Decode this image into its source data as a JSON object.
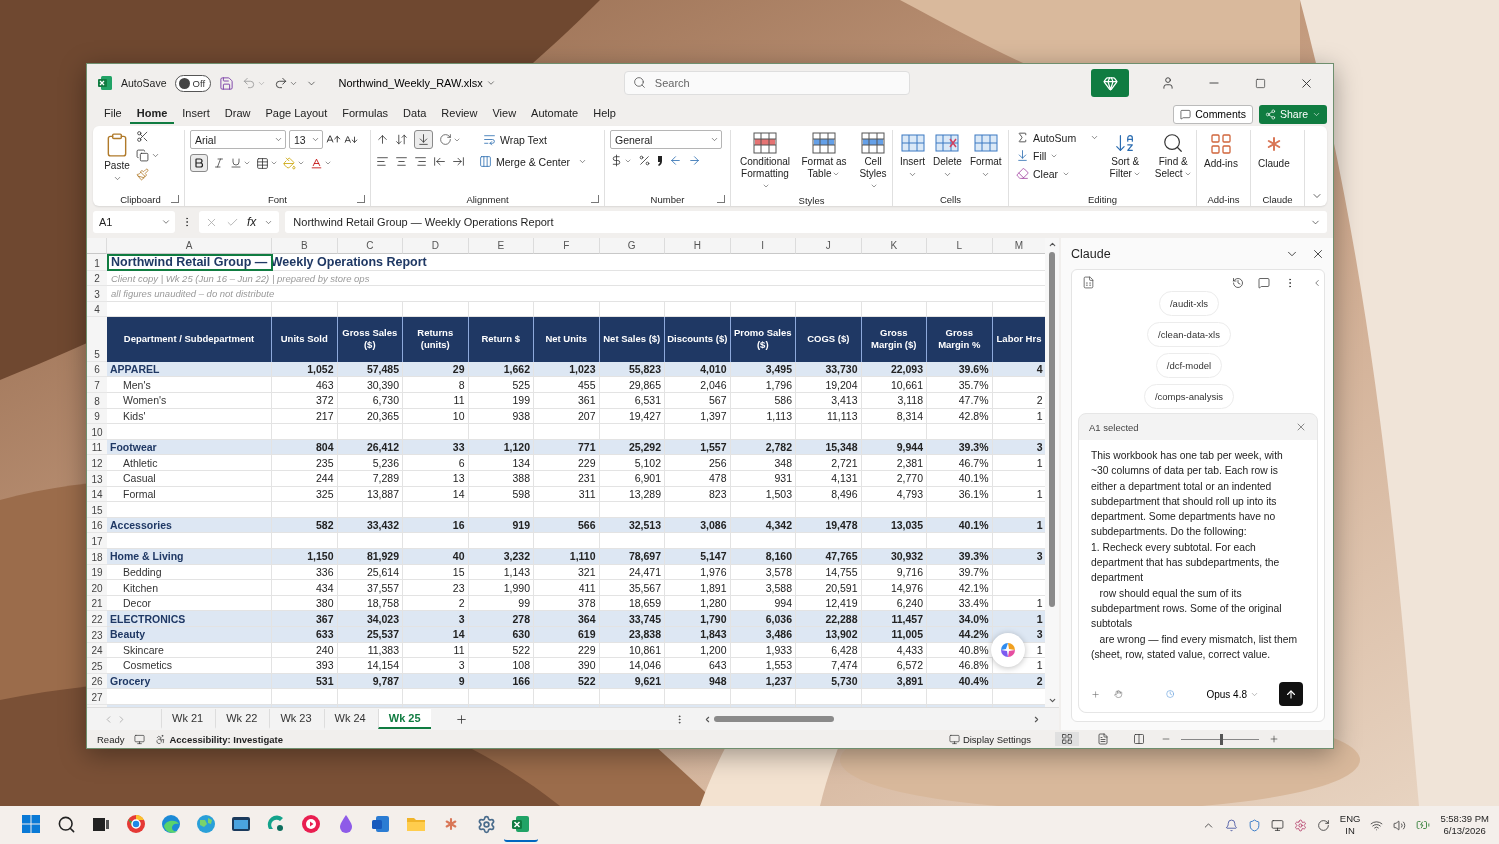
{
  "title_bar": {
    "autosave_label": "AutoSave",
    "autosave": {
      "on": false,
      "label": "Off"
    },
    "filename": "Northwind_Weekly_RAW.xlsx",
    "search": {
      "placeholder": "Search"
    }
  },
  "menu_tabs": [
    {
      "label": "File",
      "selected": false
    },
    {
      "label": "Home",
      "selected": true
    },
    {
      "label": "Insert",
      "selected": false
    },
    {
      "label": "Draw",
      "selected": false
    },
    {
      "label": "Page Layout",
      "selected": false
    },
    {
      "label": "Formulas",
      "selected": false
    },
    {
      "label": "Data",
      "selected": false
    },
    {
      "label": "Review",
      "selected": false
    },
    {
      "label": "View",
      "selected": false
    },
    {
      "label": "Automate",
      "selected": false
    },
    {
      "label": "Help",
      "selected": false
    }
  ],
  "comments_button": "Comments",
  "share_button": "Share",
  "ribbon": {
    "clipboard": {
      "label": "Clipboard",
      "paste": "Paste"
    },
    "font": {
      "label": "Font",
      "font_name": "Arial",
      "font_size": "13",
      "bold": true
    },
    "alignment": {
      "label": "Alignment",
      "align_bottom": true,
      "wrap_text": "Wrap Text",
      "merge_center": "Merge & Center"
    },
    "number": {
      "label": "Number",
      "format": "General"
    },
    "styles": {
      "label": "Styles",
      "buttons": [
        "Conditional Formatting",
        "Format as Table",
        "Cell Styles"
      ]
    },
    "cells": {
      "label": "Cells",
      "buttons": [
        "Insert",
        "Delete",
        "Format"
      ]
    },
    "editing": {
      "label": "Editing",
      "autosum": "AutoSum",
      "fill": "Fill",
      "clear": "Clear",
      "buttons": [
        "Sort & Filter",
        "Find & Select"
      ]
    },
    "addins": {
      "label": "Add-ins",
      "button": "Add-ins"
    },
    "claude": {
      "label": "Claude",
      "button": "Claude"
    }
  },
  "formula_bar": {
    "cell_ref": "A1",
    "function_label": "fx",
    "value": "Northwind Retail Group — Weekly Operations Report"
  },
  "sheet": {
    "columns": [
      "A",
      "B",
      "C",
      "D",
      "E",
      "F",
      "G",
      "H",
      "I",
      "J",
      "K",
      "L",
      "M"
    ],
    "top_rows": [
      {
        "num": "1",
        "kind": "title",
        "text": "Northwind Retail Group — Weekly Operations Report"
      },
      {
        "num": "2",
        "kind": "note",
        "text": "Client copy  |  Wk 25  (Jun 16 – Jun 22)  |  prepared by store ops"
      },
      {
        "num": "3",
        "kind": "note",
        "text": "all figures unaudited – do not distribute"
      },
      {
        "num": "4",
        "kind": "blank"
      }
    ],
    "header_row": {
      "num": "5",
      "labels": [
        "Department / Subdepartment",
        "Units Sold",
        "Gross Sales ($)",
        "Returns (units)",
        "Return $",
        "Net Units",
        "Net Sales ($)",
        "Discounts ($)",
        "Promo Sales ($)",
        "COGS ($)",
        "Gross Margin ($)",
        "Gross Margin %",
        "Labor Hrs"
      ]
    },
    "rows": [
      {
        "num": "6",
        "kind": "department",
        "name": "APPAREL",
        "values": [
          "1,052",
          "57,485",
          "29",
          "1,662",
          "1,023",
          "55,823",
          "4,010",
          "3,495",
          "33,730",
          "22,093",
          "39.6%"
        ],
        "labor_hrs": "4"
      },
      {
        "num": "7",
        "kind": "sub",
        "name": "Men's",
        "values": [
          "463",
          "30,390",
          "8",
          "525",
          "455",
          "29,865",
          "2,046",
          "1,796",
          "19,204",
          "10,661",
          "35.7%"
        ]
      },
      {
        "num": "8",
        "kind": "sub",
        "name": "Women's",
        "values": [
          "372",
          "6,730",
          "11",
          "199",
          "361",
          "6,531",
          "567",
          "586",
          "3,413",
          "3,118",
          "47.7%"
        ],
        "labor_hrs": "2"
      },
      {
        "num": "9",
        "kind": "sub",
        "name": "Kids'",
        "values": [
          "217",
          "20,365",
          "10",
          "938",
          "207",
          "19,427",
          "1,397",
          "1,113",
          "11,113",
          "8,314",
          "42.8%"
        ],
        "labor_hrs": "1"
      },
      {
        "num": "10",
        "kind": "blank"
      },
      {
        "num": "11",
        "kind": "department",
        "name": "Footwear",
        "values": [
          "804",
          "26,412",
          "33",
          "1,120",
          "771",
          "25,292",
          "1,557",
          "2,782",
          "15,348",
          "9,944",
          "39.3%"
        ],
        "labor_hrs": "3"
      },
      {
        "num": "12",
        "kind": "sub",
        "name": "Athletic",
        "values": [
          "235",
          "5,236",
          "6",
          "134",
          "229",
          "5,102",
          "256",
          "348",
          "2,721",
          "2,381",
          "46.7%"
        ],
        "labor_hrs": "1"
      },
      {
        "num": "13",
        "kind": "sub",
        "name": "Casual",
        "values": [
          "244",
          "7,289",
          "13",
          "388",
          "231",
          "6,901",
          "478",
          "931",
          "4,131",
          "2,770",
          "40.1%"
        ]
      },
      {
        "num": "14",
        "kind": "sub",
        "name": "Formal",
        "values": [
          "325",
          "13,887",
          "14",
          "598",
          "311",
          "13,289",
          "823",
          "1,503",
          "8,496",
          "4,793",
          "36.1%"
        ],
        "labor_hrs": "1"
      },
      {
        "num": "15",
        "kind": "blank"
      },
      {
        "num": "16",
        "kind": "department",
        "name": "Accessories",
        "values": [
          "582",
          "33,432",
          "16",
          "919",
          "566",
          "32,513",
          "3,086",
          "4,342",
          "19,478",
          "13,035",
          "40.1%"
        ],
        "labor_hrs": "1"
      },
      {
        "num": "17",
        "kind": "blank"
      },
      {
        "num": "18",
        "kind": "department",
        "name": "Home & Living",
        "values": [
          "1,150",
          "81,929",
          "40",
          "3,232",
          "1,110",
          "78,697",
          "5,147",
          "8,160",
          "47,765",
          "30,932",
          "39.3%"
        ],
        "labor_hrs": "3"
      },
      {
        "num": "19",
        "kind": "sub",
        "name": "Bedding",
        "values": [
          "336",
          "25,614",
          "15",
          "1,143",
          "321",
          "24,471",
          "1,976",
          "3,578",
          "14,755",
          "9,716",
          "39.7%"
        ]
      },
      {
        "num": "20",
        "kind": "sub",
        "name": "Kitchen",
        "values": [
          "434",
          "37,557",
          "23",
          "1,990",
          "411",
          "35,567",
          "1,891",
          "3,588",
          "20,591",
          "14,976",
          "42.1%"
        ]
      },
      {
        "num": "21",
        "kind": "sub",
        "name": "Decor",
        "values": [
          "380",
          "18,758",
          "2",
          "99",
          "378",
          "18,659",
          "1,280",
          "994",
          "12,419",
          "6,240",
          "33.4%"
        ],
        "labor_hrs": "1"
      },
      {
        "num": "22",
        "kind": "department",
        "name": "ELECTRONICS",
        "values": [
          "367",
          "34,023",
          "3",
          "278",
          "364",
          "33,745",
          "1,790",
          "6,036",
          "22,288",
          "11,457",
          "34.0%"
        ],
        "labor_hrs": "1"
      },
      {
        "num": "23",
        "kind": "department",
        "name": "Beauty",
        "values": [
          "633",
          "25,537",
          "14",
          "630",
          "619",
          "23,838",
          "1,843",
          "3,486",
          "13,902",
          "11,005",
          "44.2%"
        ],
        "labor_hrs": "3"
      },
      {
        "num": "24",
        "kind": "sub",
        "name": "Skincare",
        "values": [
          "240",
          "11,383",
          "11",
          "522",
          "229",
          "10,861",
          "1,200",
          "1,933",
          "6,428",
          "4,433",
          "40.8%"
        ],
        "labor_hrs": "1"
      },
      {
        "num": "25",
        "kind": "sub",
        "name": "Cosmetics",
        "values": [
          "393",
          "14,154",
          "3",
          "108",
          "390",
          "14,046",
          "643",
          "1,553",
          "7,474",
          "6,572",
          "46.8%"
        ],
        "labor_hrs": "1"
      },
      {
        "num": "26",
        "kind": "department",
        "name": "Grocery",
        "values": [
          "531",
          "9,787",
          "9",
          "166",
          "522",
          "9,621",
          "948",
          "1,237",
          "5,730",
          "3,891",
          "40.4%"
        ],
        "labor_hrs": "2"
      },
      {
        "num": "27",
        "kind": "blank"
      }
    ]
  },
  "sheet_tabs": [
    {
      "label": "Wk 21",
      "selected": false
    },
    {
      "label": "Wk 22",
      "selected": false
    },
    {
      "label": "Wk 23",
      "selected": false
    },
    {
      "label": "Wk 24",
      "selected": false
    },
    {
      "label": "Wk 25",
      "selected": true
    }
  ],
  "status_bar": {
    "ready": "Ready",
    "accessibility": "Accessibility: Investigate",
    "display_settings": "Display Settings",
    "views": [
      {
        "kind": "normal",
        "selected": true
      },
      {
        "kind": "page_layout",
        "selected": false
      },
      {
        "kind": "page_break",
        "selected": false
      }
    ],
    "zoom": {
      "level": 0.5
    }
  },
  "claude_panel": {
    "title": "Claude",
    "skills": [
      "/audit-xls",
      "/clean-data-xls",
      "/dcf-model",
      "/comps-analysis"
    ],
    "context": "A1 selected",
    "prompt": {
      "value": "This workbook has one tab per week, with ~30 columns of data per tab. Each row is either a department total or an indented subdepartment that should roll up into its department. Some departments have no subdepartments. Do the following:\n1. Recheck every subtotal. For each department that has subdepartments, the department\n   row should equal the sum of its subdepartment rows. Some of the original subtotals\n   are wrong — find every mismatch, list them (sheet, row, stated value, correct value."
    },
    "model": "Opus 4.8"
  },
  "taskbar": {
    "apps": [
      {
        "kind": "start",
        "selected": false
      },
      {
        "kind": "search",
        "selected": false
      },
      {
        "kind": "taskview",
        "selected": false
      },
      {
        "kind": "ring",
        "selected": false
      },
      {
        "kind": "wave",
        "selected": false
      },
      {
        "kind": "globe",
        "selected": false
      },
      {
        "kind": "window",
        "selected": false
      },
      {
        "kind": "arc",
        "selected": false
      },
      {
        "kind": "play",
        "selected": false
      },
      {
        "kind": "drop",
        "selected": false
      },
      {
        "kind": "doc",
        "selected": false
      },
      {
        "kind": "folder",
        "selected": false
      },
      {
        "kind": "star",
        "selected": false
      },
      {
        "kind": "gear",
        "selected": false
      },
      {
        "kind": "sheet",
        "selected": true
      }
    ],
    "language": {
      "code": "ENG",
      "region": "IN"
    },
    "clock": {
      "time": "5:58:39 PM",
      "date": "6/13/2026"
    }
  }
}
